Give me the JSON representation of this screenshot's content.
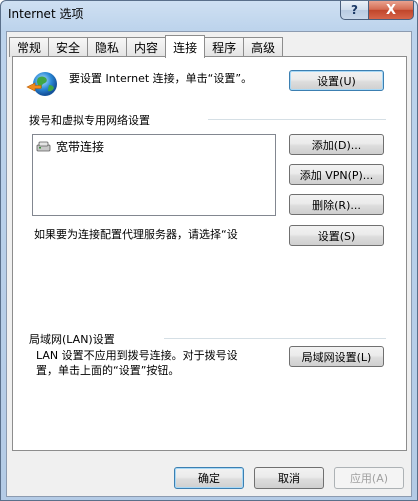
{
  "window": {
    "title": "Internet 选项"
  },
  "caption": {
    "help": "?",
    "close": "X"
  },
  "tabs": [
    {
      "label": "常规"
    },
    {
      "label": "安全"
    },
    {
      "label": "隐私"
    },
    {
      "label": "内容"
    },
    {
      "label": "连接"
    },
    {
      "label": "程序"
    },
    {
      "label": "高级"
    }
  ],
  "connections": {
    "intro_text": "要设置 Internet 连接，单击“设置”。",
    "setup_button": "设置(U)",
    "dialup_group_label": "拨号和虚拟专用网络设置",
    "list_items": [
      {
        "label": "宽带连接"
      }
    ],
    "add_button": "添加(D)...",
    "add_vpn_button": "添加 VPN(P)...",
    "remove_button": "删除(R)...",
    "proxy_text": "如果要为连接配置代理服务器，请选择“设",
    "settings_button": "设置(S)",
    "lan_group_label": "局域网(LAN)设置",
    "lan_text": "LAN 设置不应用到拨号连接。对于拨号设置，单击上面的“设置”按钮。",
    "lan_button": "局域网设置(L)"
  },
  "footer": {
    "ok": "确定",
    "cancel": "取消",
    "apply": "应用(A)"
  }
}
